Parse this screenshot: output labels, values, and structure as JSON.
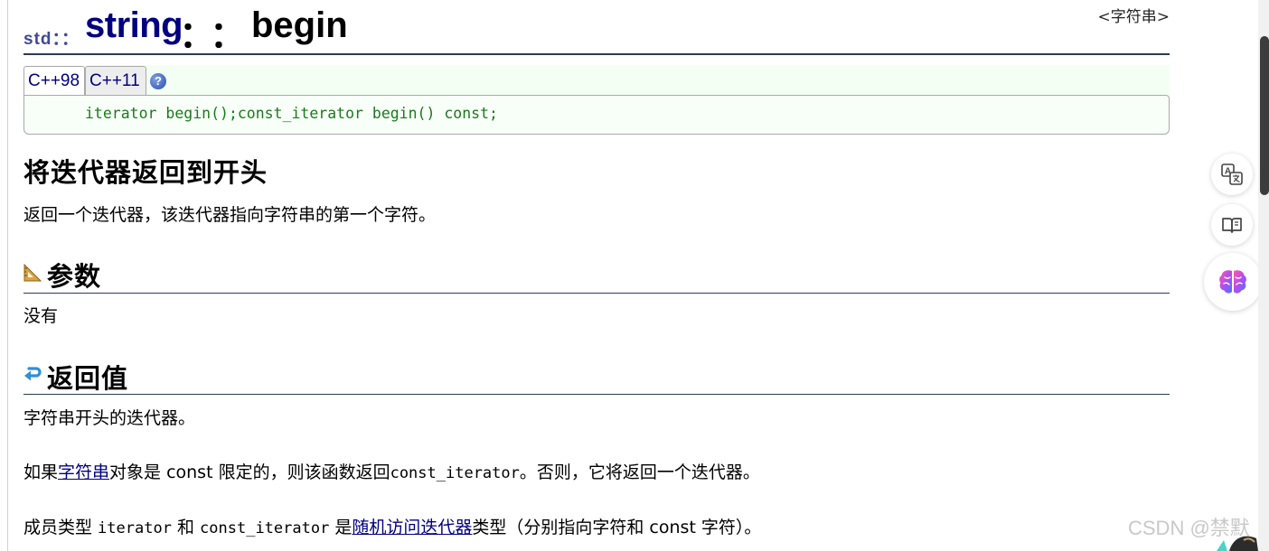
{
  "header": {
    "namespace": "std：：",
    "class_name": "string",
    "scope_op": "：：",
    "member": "begin",
    "section_tag": "<字符串>"
  },
  "prototype": {
    "tabs": [
      {
        "label": "C++98",
        "active": true
      },
      {
        "label": "C++11",
        "active": false
      }
    ],
    "help_icon": "help-question-icon",
    "code": "iterator begin();const_iterator begin() const;"
  },
  "main": {
    "heading": "将迭代器返回到开头",
    "description": "返回一个迭代器，该迭代器指向字符串的第一个字符。"
  },
  "parameters": {
    "icon": "set-square-icon",
    "heading": "参数",
    "text": "没有"
  },
  "return_value": {
    "icon": "return-arrow-icon",
    "heading": "返回值",
    "line1": "字符串开头的迭代器。",
    "line2": {
      "pre": "如果",
      "link": "字符串",
      "mid": "对象是 const 限定的，则该函数返回",
      "code": "const_iterator",
      "mid2": "。否则，它将返回一个",
      "serif": "迭代器",
      "post": "。"
    },
    "line3": {
      "pre": "成员类型 ",
      "code1": "iterator",
      "mid1": " 和 ",
      "code2": "const_iterator",
      "mid2": " 是",
      "link": "随机访问迭代器",
      "post": "类型（分别指向字符和 const 字符）。"
    }
  },
  "side_tools": [
    {
      "icon": "translate-icon"
    },
    {
      "icon": "reader-book-icon"
    },
    {
      "icon": "ai-brain-icon"
    }
  ],
  "watermark": "CSDN @禁默",
  "colors": {
    "title": "#000080",
    "link": "#000080",
    "code_green": "#1b7a1b",
    "rule": "#2b3b55",
    "proto_bg": "#f8fff8"
  }
}
